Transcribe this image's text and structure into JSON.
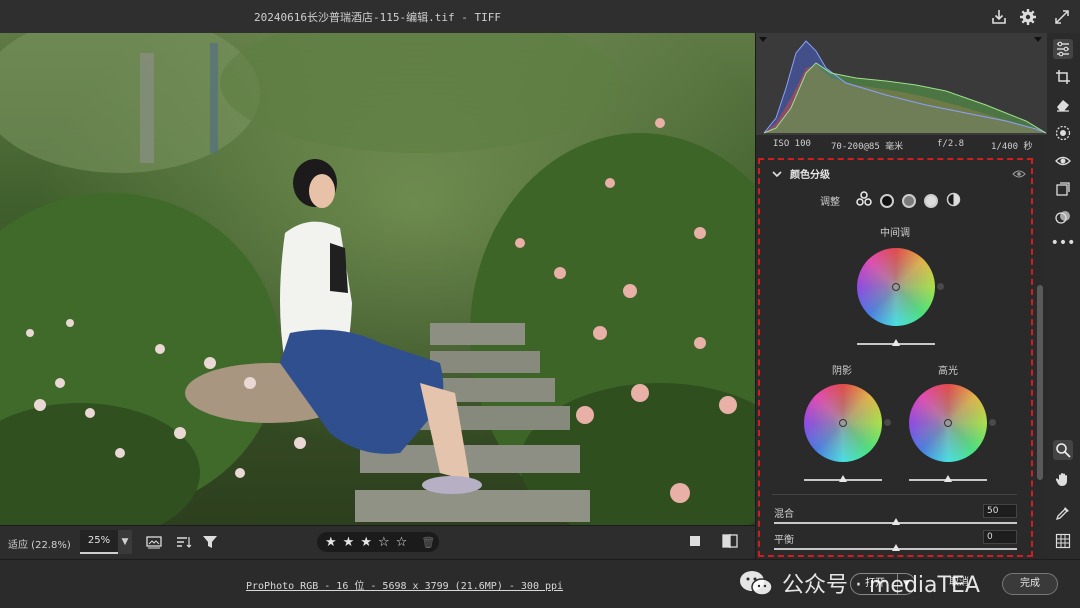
{
  "titlebar": {
    "title": "20240616长沙普瑞酒店-115-编辑.tif -  TIFF",
    "icons": [
      "save-icon",
      "gear-icon",
      "fullscreen-icon"
    ]
  },
  "histogram": {
    "iso": "ISO 100",
    "lens": "70-200@85 毫米",
    "aperture": "f/2.8",
    "shutter": "1/400 秒"
  },
  "color_grading": {
    "title": "颜色分级",
    "adjust_label": "调整",
    "midtones_label": "中间调",
    "shadows_label": "阴影",
    "highlights_label": "高光",
    "blending_label": "混合",
    "blending_value": "50",
    "balance_label": "平衡",
    "balance_value": "0"
  },
  "filmstrip": {
    "fit_label": "适应 (22.8%)",
    "zoom_value": "25%",
    "rating_stars": 3,
    "rating_max": 5
  },
  "bottombar": {
    "file_info": "ProPhoto RGB - 16 位 - 5698 x 3799 (21.6MP) - 300 ppi",
    "open_label": "打开",
    "cancel_label": "取消",
    "done_label": "完成"
  },
  "watermark": {
    "text": "公众号 · mediaTEA"
  },
  "colors": {
    "panel_bg": "#2a2a2a",
    "highlight_border": "#d01d1d",
    "hist_red": "#c84a4a",
    "hist_green": "#5aa84a",
    "hist_blue": "#4a60c8"
  }
}
